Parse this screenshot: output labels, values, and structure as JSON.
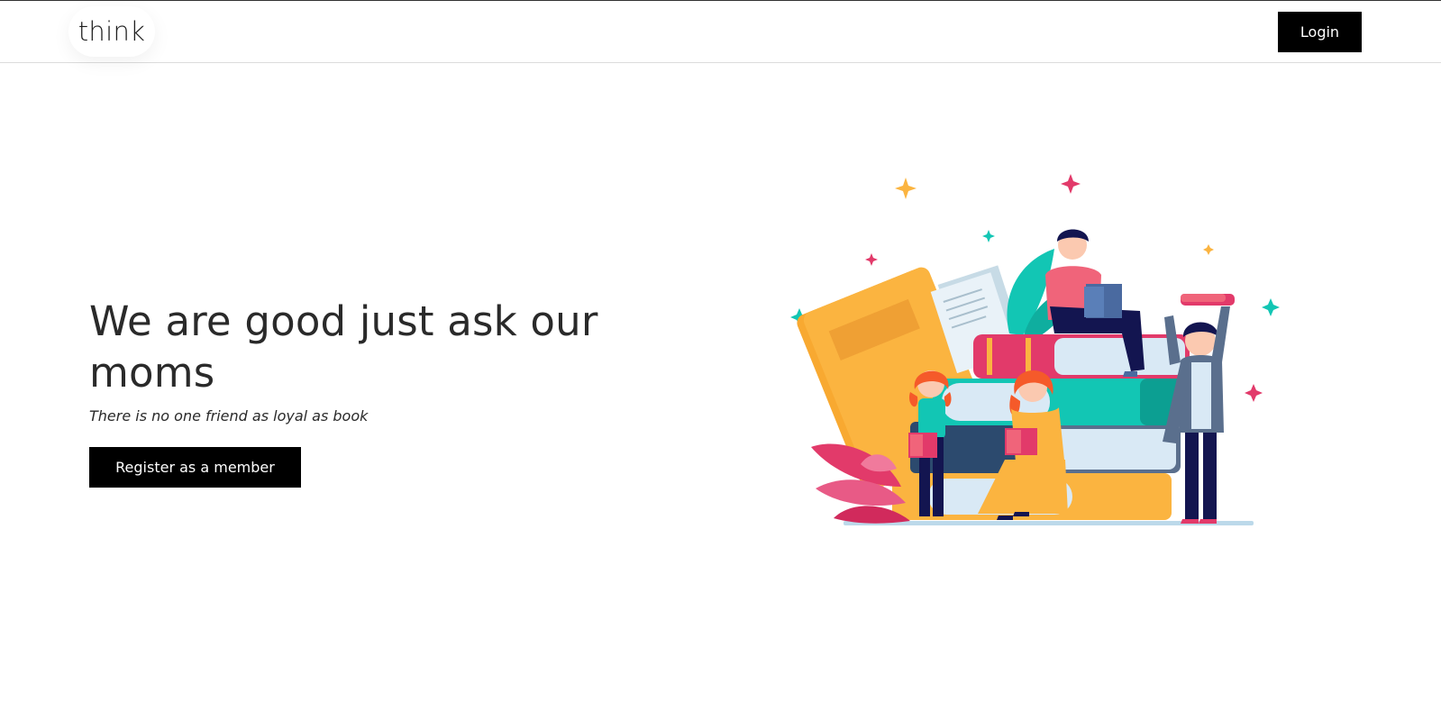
{
  "navbar": {
    "logo": "think",
    "login_label": "Login"
  },
  "hero": {
    "title": "We are good just ask our moms",
    "subtitle": "There is no one friend as loyal as book",
    "register_label": "Register as a member"
  },
  "illustration": {
    "icon": "reading-kids-books-illustration",
    "colors": {
      "yellow": "#fbb440",
      "pink": "#e23a6a",
      "teal": "#12c6b4",
      "navy": "#131550",
      "lightblue": "#d9e9f5",
      "slate": "#5a6f8d"
    }
  }
}
